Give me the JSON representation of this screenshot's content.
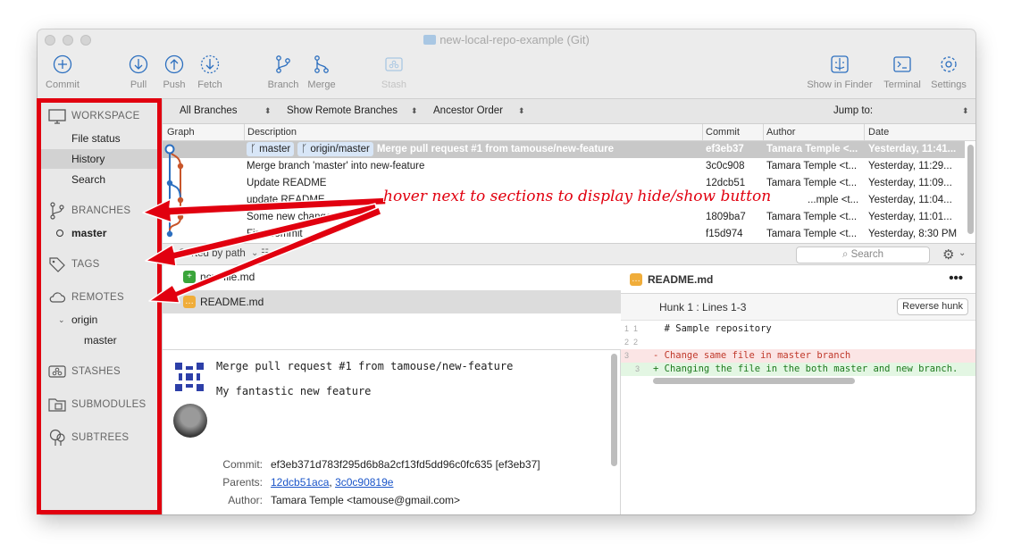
{
  "window": {
    "title": "new-local-repo-example (Git)"
  },
  "toolbar": {
    "commit": "Commit",
    "pull": "Pull",
    "push": "Push",
    "fetch": "Fetch",
    "branch": "Branch",
    "merge": "Merge",
    "stash": "Stash",
    "show_in_finder": "Show in Finder",
    "terminal": "Terminal",
    "settings": "Settings"
  },
  "sidebar": {
    "workspace": "WORKSPACE",
    "workspace_items": [
      "File status",
      "History",
      "Search"
    ],
    "branches": "BRANCHES",
    "branch_items": [
      "master"
    ],
    "tags": "TAGS",
    "remotes": "REMOTES",
    "remote_name": "origin",
    "remote_branches": [
      "master"
    ],
    "stashes": "STASHES",
    "submodules": "SUBMODULES",
    "subtrees": "SUBTREES"
  },
  "filters": {
    "branches": "All Branches",
    "remote": "Show Remote Branches",
    "order": "Ancestor Order",
    "jump_to": "Jump to:"
  },
  "columns": {
    "graph": "Graph",
    "description": "Description",
    "commit": "Commit",
    "author": "Author",
    "date": "Date"
  },
  "commits": [
    {
      "tags": [
        "master",
        "origin/master"
      ],
      "description": "Merge pull request #1 from tamouse/new-feature",
      "hash": "ef3eb37",
      "author": "Tamara Temple <...",
      "date": "Yesterday, 11:41..."
    },
    {
      "tags": [],
      "description": "Merge branch 'master' into new-feature",
      "hash": "3c0c908",
      "author": "Tamara Temple <t...",
      "date": "Yesterday, 11:29..."
    },
    {
      "tags": [],
      "description": "Update README",
      "hash": "12dcb51",
      "author": "Tamara Temple <t...",
      "date": "Yesterday, 11:09..."
    },
    {
      "tags": [],
      "description": "update README",
      "hash": "",
      "author": "...mple <t...",
      "date": "Yesterday, 11:04..."
    },
    {
      "tags": [],
      "description": "Some new changes",
      "hash": "1809ba7",
      "author": "Tamara Temple <t...",
      "date": "Yesterday, 11:01..."
    },
    {
      "tags": [],
      "description": "First commit",
      "hash": "f15d974",
      "author": "Tamara Temple <t...",
      "date": "Yesterday, 8:30 PM"
    }
  ],
  "midbar": {
    "sort": "Sorted by path",
    "search_placeholder": "Search"
  },
  "files": [
    {
      "name": "new-file.md",
      "status": "added",
      "badge": "+"
    },
    {
      "name": "README.md",
      "status": "modified",
      "badge": "…"
    }
  ],
  "commit_detail": {
    "subject": "Merge pull request #1 from tamouse/new-feature",
    "body": "My fantastic new feature",
    "commit_label": "Commit:",
    "commit_value": "ef3eb371d783f295d6b8a2cf13fd5dd96c0fc635 [ef3eb37]",
    "parents_label": "Parents:",
    "parents": [
      "12dcb51aca",
      "3c0c90819e"
    ],
    "author_label": "Author:",
    "author_value": "Tamara Temple <tamouse@gmail.com>"
  },
  "diff": {
    "file": "README.md",
    "hunk": "Hunk 1 : Lines 1-3",
    "reverse": "Reverse hunk",
    "lines": [
      {
        "old": "1",
        "new": "1",
        "type": "ctx",
        "text": "  # Sample repository"
      },
      {
        "old": "2",
        "new": "2",
        "type": "ctx",
        "text": " "
      },
      {
        "old": "3",
        "new": "",
        "type": "del",
        "text": "- Change same file in master branch"
      },
      {
        "old": "",
        "new": "3",
        "type": "add",
        "text": "+ Changing the file in the both master and new branch."
      }
    ]
  },
  "annotation": {
    "text": "hover next to sections to display hide/show button"
  },
  "colors": {
    "annotation_red": "#e1000f",
    "accent_blue": "#2c6fbf",
    "merge_orange": "#c8552a"
  }
}
